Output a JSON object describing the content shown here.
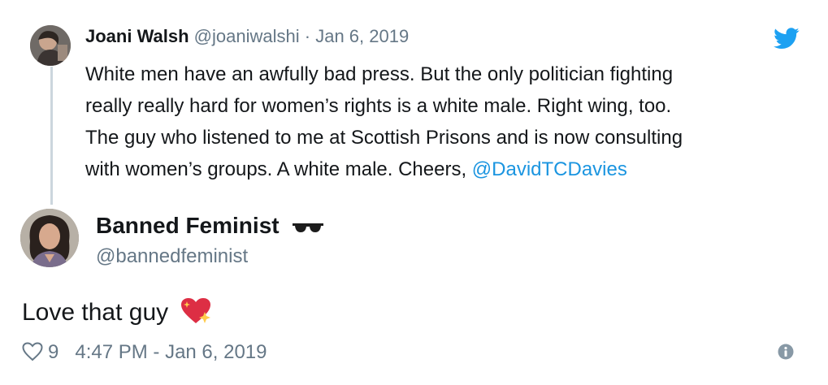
{
  "quoted_tweet": {
    "name": "Joani Walsh",
    "handle": "@joaniwalshi",
    "separator": "·",
    "date": "Jan 6, 2019",
    "text_lines": [
      "White men have an awfully bad press. But the only politician fighting",
      "really really hard for women’s rights is a white male. Right wing, too.",
      "The guy who listened to me at Scottish Prisons and is now consulting",
      "with women’s groups. A white male. Cheers, "
    ],
    "mention": "@DavidTCDavies"
  },
  "reply_tweet": {
    "name": "Banned Feminist",
    "name_emoji_icon": "sunglasses-icon",
    "handle": "@bannedfeminist",
    "text": "Love that guy",
    "text_emoji_icon": "sparkling-heart-icon",
    "like_count": "9",
    "timestamp": "4:47 PM - Jan 6, 2019"
  },
  "colors": {
    "link": "#1b95e0",
    "secondary_text": "#657786",
    "thread_line": "#ccd6dd",
    "twitter_blue": "#1da1f2"
  }
}
